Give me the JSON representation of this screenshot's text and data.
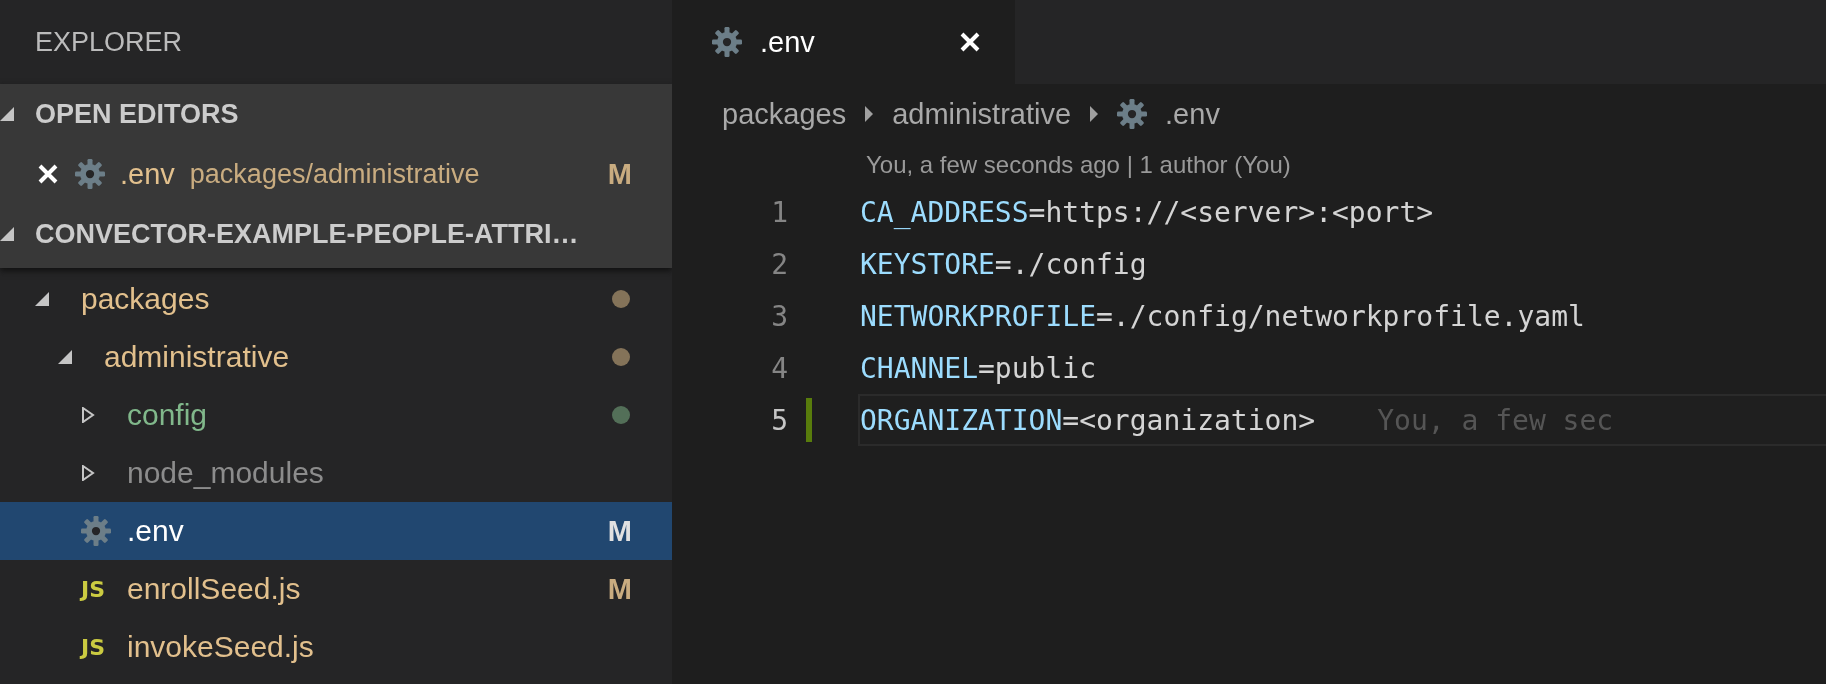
{
  "sidebar": {
    "title": "EXPLORER",
    "open_editors": {
      "title": "OPEN EDITORS",
      "expanded": true,
      "items": [
        {
          "name": ".env",
          "path": "packages/administrative",
          "kind": "config_file",
          "color": "#e2c08d",
          "badge": "M"
        }
      ]
    },
    "project": {
      "title": "CONVECTOR-EXAMPLE-PEOPLE-ATTRI…",
      "expanded": true,
      "tree": [
        {
          "label": "packages",
          "kind": "folder",
          "expanded": true,
          "selected": false,
          "color": "#e2c08d",
          "children": [
            {
              "label": "administrative",
              "kind": "folder",
              "expanded": true,
              "selected": false,
              "color": "#e2c08d",
              "children": [
                {
                  "label": "config",
                  "kind": "folder",
                  "expanded": false,
                  "selected": false,
                  "color": "#81b88b"
                },
                {
                  "label": "node_modules",
                  "kind": "folder",
                  "expanded": false,
                  "selected": false,
                  "color": "#8c8c8c"
                },
                {
                  "label": ".env",
                  "kind": "config_file",
                  "selected": true,
                  "color": "#ffffff",
                  "badge": "M"
                },
                {
                  "label": "enrollSeed.js",
                  "kind": "js_file",
                  "icon_text": "JS",
                  "selected": false,
                  "color": "#e2c08d",
                  "badge": "M"
                },
                {
                  "label": "invokeSeed.js",
                  "kind": "js_file",
                  "icon_text": "JS",
                  "selected": false,
                  "color": "#e2c08d"
                }
              ]
            }
          ]
        }
      ]
    }
  },
  "editor": {
    "tabs": [
      {
        "label": ".env",
        "kind": "config_file",
        "selected": true
      }
    ],
    "breadcrumbs": [
      {
        "label": "packages",
        "kind": "folder"
      },
      {
        "label": "administrative",
        "kind": "folder"
      },
      {
        "label": ".env",
        "kind": "config_file"
      }
    ],
    "blame": "You, a few seconds ago | 1 author (You)",
    "lines": [
      {
        "number": "1",
        "key": "CA_ADDRESS",
        "value": "=https://<server>:<port>",
        "modified": false,
        "current": false
      },
      {
        "number": "2",
        "key": "KEYSTORE",
        "value": "=./config",
        "modified": false,
        "current": false
      },
      {
        "number": "3",
        "key": "NETWORKPROFILE",
        "value": "=./config/networkprofile.yaml",
        "modified": false,
        "current": false
      },
      {
        "number": "4",
        "key": "CHANNEL",
        "value": "=public",
        "modified": false,
        "current": false
      },
      {
        "number": "5",
        "key": "ORGANIZATION",
        "value": "=<organization>",
        "modified": true,
        "current": true,
        "annotation": "You, a few sec"
      }
    ]
  }
}
